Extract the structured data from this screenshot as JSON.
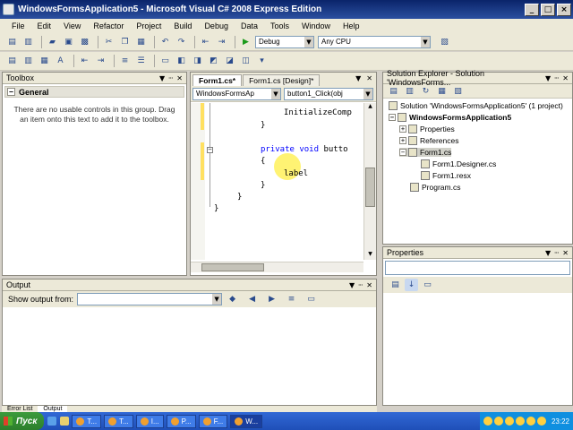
{
  "window": {
    "title": "WindowsFormsApplication5 - Microsoft Visual C# 2008 Express Edition",
    "controls": [
      "_",
      "□",
      "×"
    ]
  },
  "menu": [
    "File",
    "Edit",
    "View",
    "Refactor",
    "Project",
    "Build",
    "Debug",
    "Data",
    "Tools",
    "Window",
    "Help"
  ],
  "toolbar": {
    "config_value": "Debug",
    "platform_value": "Any CPU"
  },
  "toolbox": {
    "title": "Toolbox",
    "group_label": "General",
    "empty_message": "There are no usable controls in this group. Drag an item onto this text to add it to the toolbox."
  },
  "editor": {
    "tabs": [
      "Form1.cs*",
      "Form1.cs [Design]*"
    ],
    "nav_class": "WindowsFormsAp",
    "nav_member": "button1_Click(obj",
    "lines": {
      "l1": "InitializeComp",
      "l2": "}",
      "l3_kw": "private void",
      "l3_rest": " butto",
      "l4": "{",
      "l5": "label",
      "l6": "}",
      "l7": "}",
      "l8": "}"
    }
  },
  "solution_explorer": {
    "title": "Solution Explorer - Solution 'WindowsForms...",
    "items": {
      "solution": "Solution 'WindowsFormsApplication5' (1 project)",
      "project": "WindowsFormsApplication5",
      "properties": "Properties",
      "references": "References",
      "form1": "Form1.cs",
      "designer": "Form1.Designer.cs",
      "resx": "Form1.resx",
      "program": "Program.cs"
    }
  },
  "properties": {
    "title": "Properties"
  },
  "output": {
    "title": "Output",
    "show_from_label": "Show output from:"
  },
  "bottom_tabs": [
    "Error List",
    "Output"
  ],
  "taskbar": {
    "start": "Пуск",
    "tasks": [
      "T...",
      "T...",
      "I...",
      "P...",
      "F...",
      "W..."
    ],
    "clock": "23:22"
  }
}
